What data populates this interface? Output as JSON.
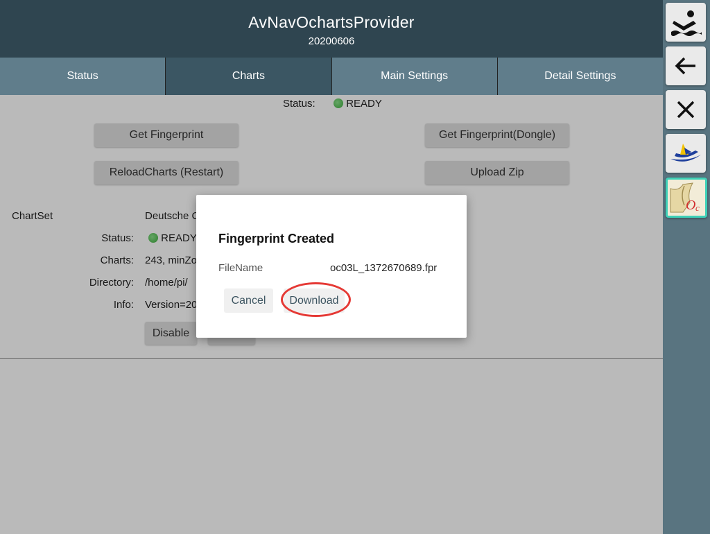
{
  "header": {
    "title": "AvNavOchartsProvider",
    "version": "20200606"
  },
  "tabs": [
    {
      "label": "Status",
      "active": false
    },
    {
      "label": "Charts",
      "active": true
    },
    {
      "label": "Main Settings",
      "active": false
    },
    {
      "label": "Detail Settings",
      "active": false
    }
  ],
  "top_status": {
    "label": "Status:",
    "value": "READY"
  },
  "buttons": {
    "get_fingerprint": "Get Fingerprint",
    "get_fingerprint_dongle": "Get Fingerprint(Dongle)",
    "reload_charts": "ReloadCharts (Restart)",
    "upload_zip": "Upload Zip"
  },
  "chartset": {
    "header_label": "ChartSet",
    "name": "Deutsche C",
    "status_label": "Status:",
    "status_value": "READY",
    "charts_label": "Charts:",
    "charts_value": "243, minZo",
    "directory_label": "Directory:",
    "directory_value": "/home/pi/",
    "info_label": "Info:",
    "info_value": "Version=20",
    "disable_label": "Disable"
  },
  "dialog": {
    "title": "Fingerprint Created",
    "filename_label": "FileName",
    "filename_value": "oc03L_1372670689.fpr",
    "cancel_label": "Cancel",
    "download_label": "Download"
  },
  "sidebar": {
    "items": [
      "boat-in-water-icon",
      "back-arrow-icon",
      "close-icon",
      "avnav-boat-icon",
      "ocharts-icon"
    ]
  },
  "colors": {
    "header": "#2f4550",
    "tab": "#607d8b",
    "tab_active": "#3b5663",
    "sidebar": "#597480",
    "highlight_ring": "#e53935",
    "status_green": "#4caf50"
  }
}
